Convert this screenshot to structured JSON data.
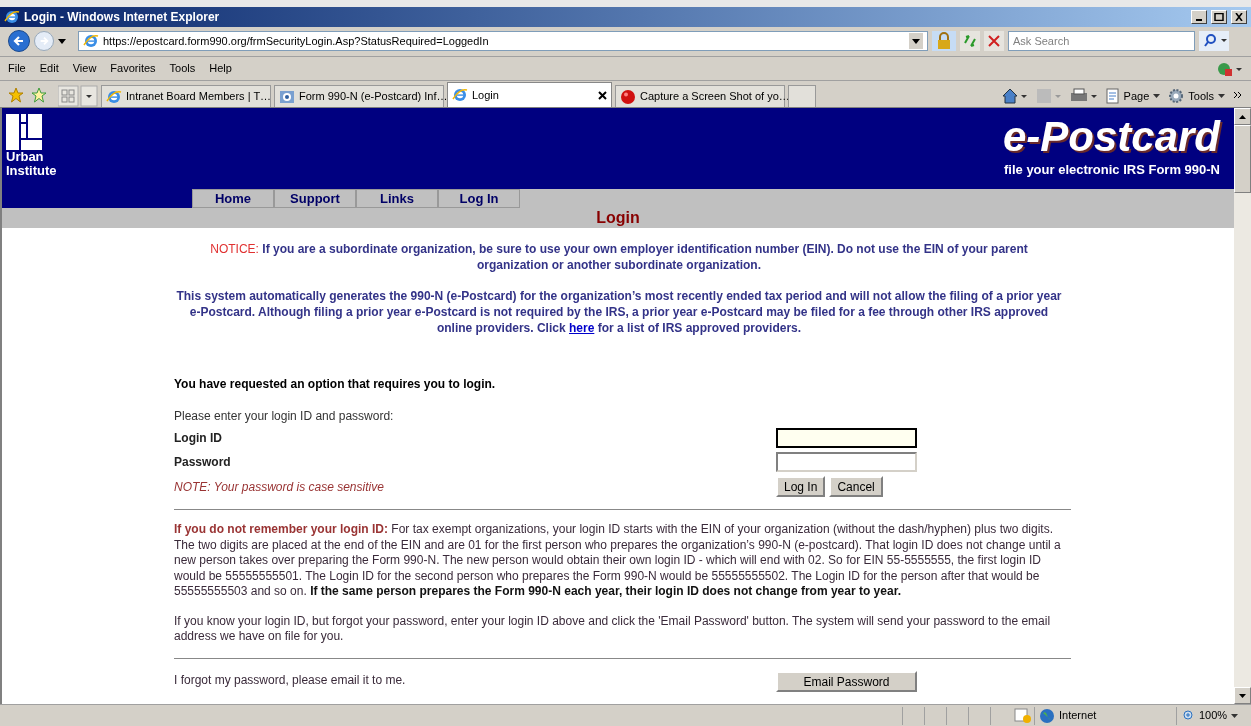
{
  "window": {
    "title": "Login - Windows Internet Explorer"
  },
  "address_bar": {
    "url": "https://epostcard.form990.org/frmSecurityLogin.Asp?StatusRequired=LoggedIn"
  },
  "search": {
    "placeholder": "Ask Search"
  },
  "menu": [
    "File",
    "Edit",
    "View",
    "Favorites",
    "Tools",
    "Help"
  ],
  "tabs": [
    {
      "label": "Intranet Board Members | T…",
      "selected": false,
      "kind": "ie"
    },
    {
      "label": "Form 990-N (e-Postcard) Inf…",
      "selected": false,
      "kind": "irs"
    },
    {
      "label": "Login",
      "selected": true,
      "kind": "ie"
    },
    {
      "label": "Capture a Screen Shot of yo…",
      "selected": false,
      "kind": "red"
    }
  ],
  "command_bar": [
    "Page",
    "Tools"
  ],
  "site": {
    "logo_lines": [
      "Urban",
      "Institute"
    ],
    "brand": "e-Postcard",
    "tagline": "file your electronic IRS Form 990-N",
    "nav": [
      {
        "label": "Home"
      },
      {
        "label": "Support"
      },
      {
        "label": "Links"
      },
      {
        "label": "Log In"
      }
    ],
    "page_title": "Login"
  },
  "notice": {
    "label": "NOTICE:",
    "text": "If you are a subordinate organization, be sure to use your own employer identification number (EIN). Do not use the EIN of your parent organization or another subordinate organization."
  },
  "info": {
    "before": "This system automatically generates the 990-N (e-Postcard) for the organization’s most recently ended tax period and will not allow the filing of a prior year e-Postcard. Although filing a prior year e-Postcard is not required by the IRS, a prior year e-Postcard may be filed for a fee through other IRS approved online providers. Click",
    "link": "here",
    "after": "for a list of IRS approved providers."
  },
  "login": {
    "heading": "You have requested an option that requires you to login.",
    "prompt": "Please enter your login ID and password:",
    "fields": [
      {
        "label": "Login ID",
        "focused": true
      },
      {
        "label": "Password",
        "focused": false
      }
    ],
    "note": "NOTE: Your password is case sensitive",
    "buttons": [
      "Log In",
      "Cancel"
    ]
  },
  "help": {
    "lead": "If you do not remember your login ID:",
    "text": "For tax exempt organizations, your login ID starts with the EIN of your organization (without the dash/hyphen) plus two digits. The two digits are placed at the end of the EIN and are 01 for the first person who prepares the organization’s 990-N (e-postcard). That login ID does not change until a new person takes over preparing the Form 990-N. The new person would obtain their own login ID - which will end with 02. So for EIN 55-5555555, the first login ID would be 55555555501. The Login ID for the second person who prepares the Form 990-N would be 55555555502. The Login ID for the person after that would be 55555555503 and so on. **If the same person prepares the Form 990-N each year, their login ID does not change from year to year.**",
    "forgot": "If you know your login ID, but forgot your password, enter your login ID above and click the 'Email Password' button. The system will send your password to the email address we have on file for you."
  },
  "email_row": {
    "text": "I forgot my password, please email it to me.",
    "button": "Email Password"
  },
  "status_bar": {
    "zone": "Internet",
    "zoom": "100%"
  }
}
